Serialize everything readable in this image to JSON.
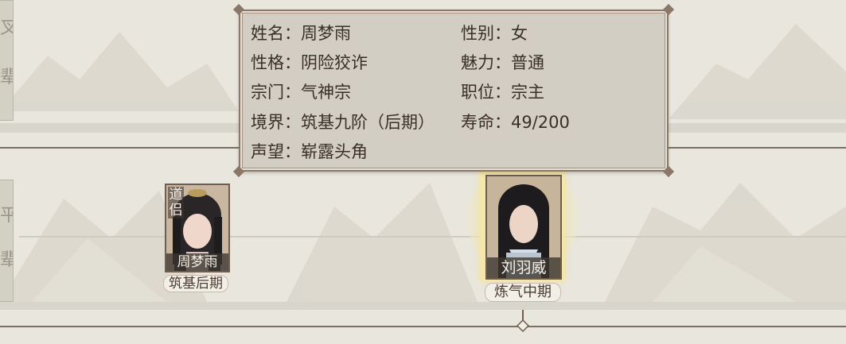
{
  "side_labels": {
    "upper": [
      "叉",
      "辈"
    ],
    "lower": [
      "平",
      "辈"
    ]
  },
  "tooltip": {
    "name_row": "姓名：周梦雨",
    "gender_row": "性别：女",
    "personality_row": "性格：阴险狡诈",
    "charm_row": "魅力：普通",
    "sect_row": "宗门：气神宗",
    "position_row": "职位：宗主",
    "realm_row": "境界：筑基九阶（后期）",
    "lifespan_row": "寿命：49/200",
    "reputation_row": "声望：崭露头角"
  },
  "characters": [
    {
      "name": "周梦雨",
      "realm": "筑基后期",
      "tag": "道侣"
    },
    {
      "name": "刘羽威",
      "realm": "炼气中期"
    }
  ],
  "colors": {
    "background": "#e7e5dc",
    "panel": "#d3cec3",
    "border": "#8b7768",
    "highlight": "#f4e7a8"
  }
}
